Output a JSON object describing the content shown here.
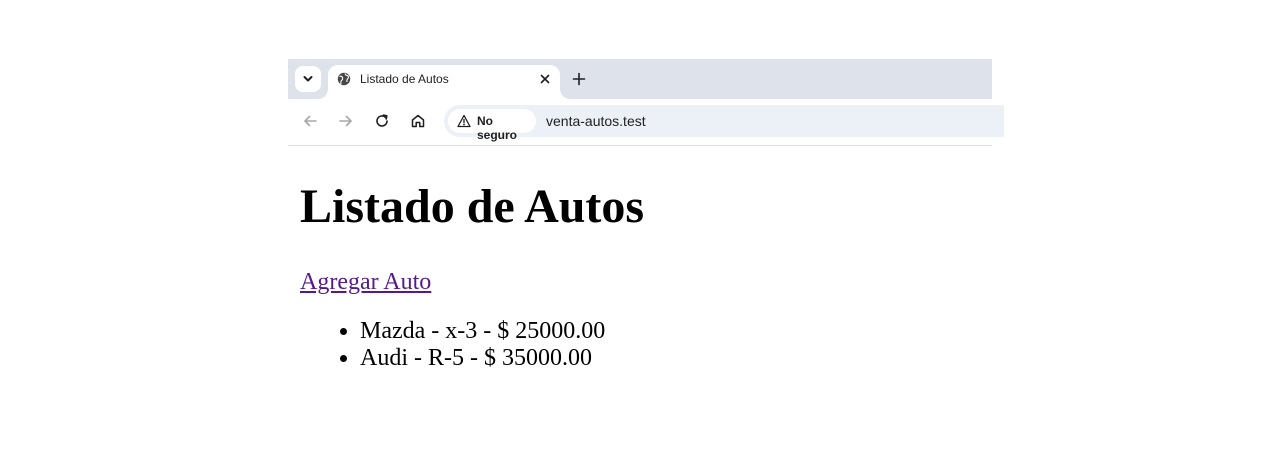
{
  "browser": {
    "tab": {
      "title": "Listado de Autos"
    },
    "omnibox": {
      "security_label": "No seguro",
      "url": "venta-autos.test"
    }
  },
  "page": {
    "heading": "Listado de Autos",
    "add_link": "Agregar Auto",
    "cars": [
      "Mazda - x-3 - $ 25000.00",
      "Audi - R-5 - $ 35000.00"
    ]
  },
  "colors": {
    "tabstrip_bg": "#dee3eb",
    "omnibox_bg": "#ecf0f7",
    "visited_link": "#551a8b"
  }
}
